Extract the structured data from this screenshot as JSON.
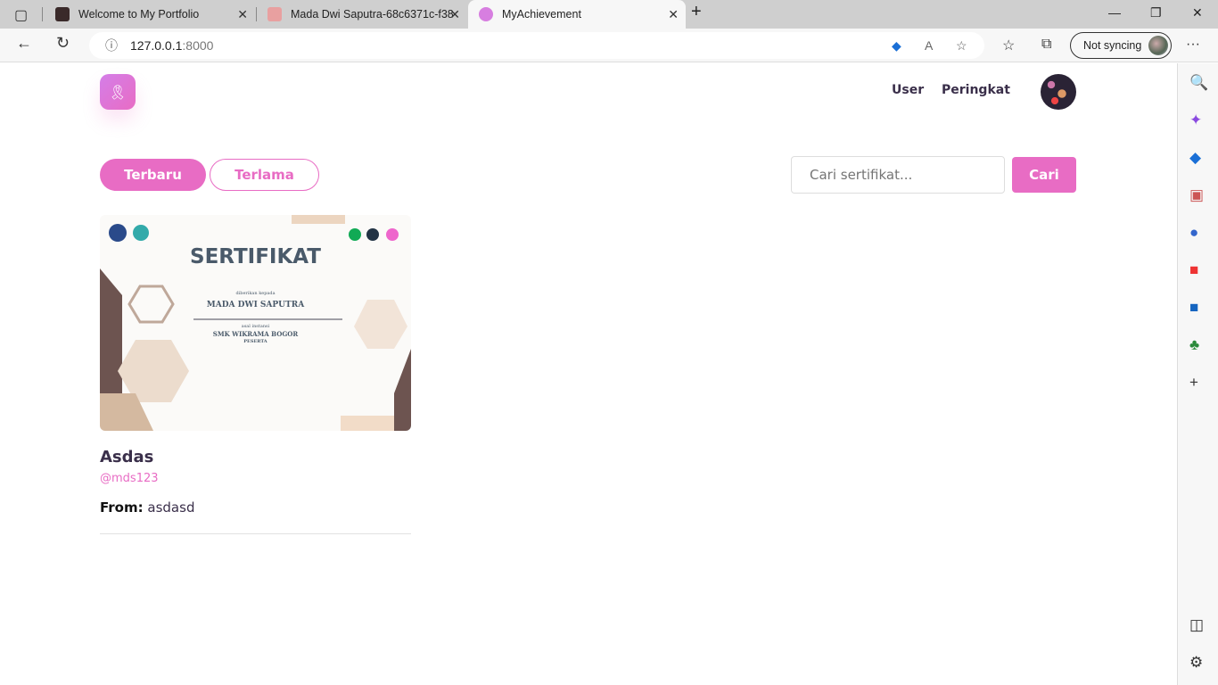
{
  "browser": {
    "tabs": [
      {
        "title": "Welcome to My Portfolio"
      },
      {
        "title": "Mada Dwi Saputra-68c6371c-f38"
      },
      {
        "title": "MyAchievement"
      }
    ],
    "url_host": "127.0.0.1",
    "url_port": ":8000",
    "sync_label": "Not syncing"
  },
  "nav": {
    "user": "User",
    "ranking": "Peringkat"
  },
  "filters": {
    "newest": "Terbaru",
    "oldest": "Terlama"
  },
  "search": {
    "placeholder": "Cari sertifikat...",
    "button": "Cari"
  },
  "card": {
    "certificate": {
      "heading": "SERTIFIKAT",
      "given_to": "diberikan kepada",
      "name": "MADA DWI SAPUTRA",
      "origin_label": "asal instansi",
      "school": "SMK WIKRAMA BOGOR",
      "role": "PESERTA"
    },
    "title": "Asdas",
    "username": "@mds123",
    "from_label": "From:",
    "from_value": "asdasd"
  },
  "colors": {
    "accent": "#e86cc4",
    "text": "#3a2f4a"
  }
}
